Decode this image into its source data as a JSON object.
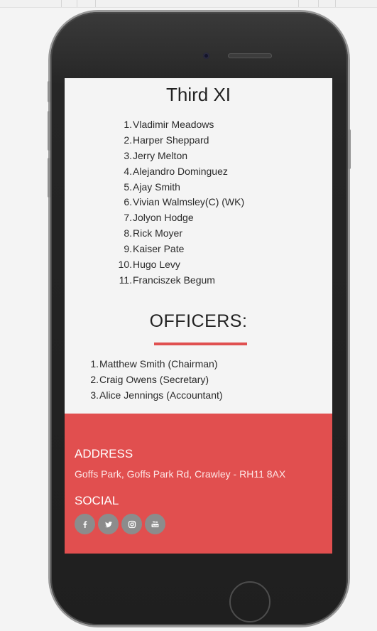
{
  "team": {
    "title": "Third XI",
    "players": [
      {
        "n": "1.",
        "name": "Vladimir Meadows"
      },
      {
        "n": "2.",
        "name": "Harper Sheppard"
      },
      {
        "n": "3.",
        "name": "Jerry Melton"
      },
      {
        "n": "4.",
        "name": "Alejandro Dominguez"
      },
      {
        "n": "5.",
        "name": "Ajay Smith"
      },
      {
        "n": "6.",
        "name": "Vivian Walmsley(C) (WK)"
      },
      {
        "n": "7.",
        "name": "Jolyon Hodge"
      },
      {
        "n": "8.",
        "name": "Rick Moyer"
      },
      {
        "n": "9.",
        "name": "Kaiser Pate"
      },
      {
        "n": "10.",
        "name": "Hugo Levy"
      },
      {
        "n": "11.",
        "name": "Franciszek Begum"
      }
    ]
  },
  "officers": {
    "title": "OFFICERS:",
    "list": [
      {
        "n": "1.",
        "name": "Matthew Smith (Chairman)"
      },
      {
        "n": "2.",
        "name": "Craig Owens (Secretary)"
      },
      {
        "n": "3.",
        "name": "Alice Jennings (Accountant)"
      }
    ]
  },
  "footer": {
    "address_heading": "ADDRESS",
    "address": "Goffs Park, Goffs Park Rd, Crawley - RH11 8AX",
    "social_heading": "SOCIAL",
    "social_icons": [
      "facebook-icon",
      "twitter-icon",
      "instagram-icon",
      "youtube-icon"
    ]
  },
  "colors": {
    "accent": "#e14f4f",
    "social_icon_bg": "#8c8c8c"
  }
}
